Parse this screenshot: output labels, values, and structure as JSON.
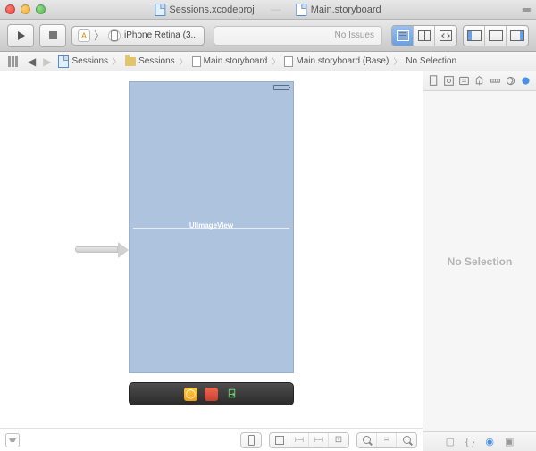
{
  "titlebar": {
    "tabs": [
      {
        "label": "Sessions.xcodeproj"
      },
      {
        "label": "Main.storyboard"
      }
    ]
  },
  "toolbar": {
    "scheme_app": "A",
    "scheme_device": "iPhone Retina (3...",
    "activity_status": "No Issues"
  },
  "jumpbar": {
    "items": [
      "Sessions",
      "Sessions",
      "Main.storyboard",
      "Main.storyboard (Base)",
      "No Selection"
    ]
  },
  "canvas": {
    "object_label": "UIImageView"
  },
  "inspector": {
    "body_text": "No Selection"
  },
  "library": {
    "tab1": "▢",
    "tab2": "{ }",
    "tab3": "◉",
    "tab4": "▣"
  }
}
